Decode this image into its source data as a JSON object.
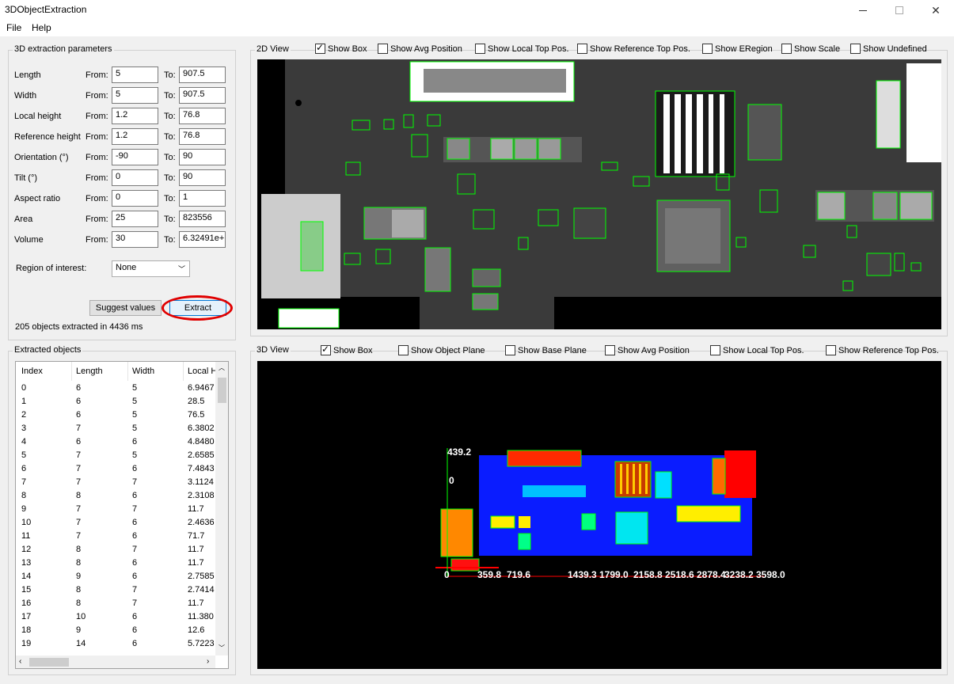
{
  "window": {
    "title": "3DObjectExtraction",
    "min_icon": "minimize-icon",
    "max_icon": "maximize-icon",
    "close_icon": "close-icon"
  },
  "menu": [
    "File",
    "Help"
  ],
  "params": {
    "group_title": "3D extraction parameters",
    "from_label": "From:",
    "to_label": "To:",
    "rows": [
      {
        "label": "Length",
        "from": "5",
        "to": "907.5"
      },
      {
        "label": "Width",
        "from": "5",
        "to": "907.5"
      },
      {
        "label": "Local height",
        "from": "1.2",
        "to": "76.8"
      },
      {
        "label": "Reference height",
        "from": "1.2",
        "to": "76.8"
      },
      {
        "label": "Orientation (°)",
        "from": "-90",
        "to": "90"
      },
      {
        "label": "Tilt (°)",
        "from": "0",
        "to": "90"
      },
      {
        "label": "Aspect ratio",
        "from": "0",
        "to": "1"
      },
      {
        "label": "Area",
        "from": "25",
        "to": "823556"
      },
      {
        "label": "Volume",
        "from": "30",
        "to": "6.32491e+"
      }
    ],
    "roi_label": "Region of interest:",
    "roi_value": "None",
    "suggest_label": "Suggest values",
    "extract_label": "Extract",
    "status": "205 objects extracted in 4436 ms",
    "highlight_color": "#e00000"
  },
  "objects": {
    "group_title": "Extracted objects",
    "columns": [
      "Index",
      "Length",
      "Width",
      "Local H"
    ],
    "rows": [
      [
        "0",
        "6",
        "5",
        "6.9467"
      ],
      [
        "1",
        "6",
        "5",
        "28.5"
      ],
      [
        "2",
        "6",
        "5",
        "76.5"
      ],
      [
        "3",
        "7",
        "5",
        "6.3802"
      ],
      [
        "4",
        "6",
        "6",
        "4.8480"
      ],
      [
        "5",
        "7",
        "5",
        "2.6585"
      ],
      [
        "6",
        "7",
        "6",
        "7.4843"
      ],
      [
        "7",
        "7",
        "7",
        "3.1124"
      ],
      [
        "8",
        "8",
        "6",
        "2.3108"
      ],
      [
        "9",
        "7",
        "7",
        "11.7"
      ],
      [
        "10",
        "7",
        "6",
        "2.4636"
      ],
      [
        "11",
        "7",
        "6",
        "71.7"
      ],
      [
        "12",
        "8",
        "7",
        "11.7"
      ],
      [
        "13",
        "8",
        "6",
        "11.7"
      ],
      [
        "14",
        "9",
        "6",
        "2.7585"
      ],
      [
        "15",
        "8",
        "7",
        "2.7414"
      ],
      [
        "16",
        "8",
        "7",
        "11.7"
      ],
      [
        "17",
        "10",
        "6",
        "11.380"
      ],
      [
        "18",
        "9",
        "6",
        "12.6"
      ],
      [
        "19",
        "14",
        "6",
        "5.7223"
      ]
    ]
  },
  "view2d": {
    "title": "2D View",
    "checkboxes": [
      {
        "label": "Show Box",
        "checked": true
      },
      {
        "label": "Show Avg Position",
        "checked": false
      },
      {
        "label": "Show Local Top Pos.",
        "checked": false
      },
      {
        "label": "Show Reference Top Pos.",
        "checked": false
      },
      {
        "label": "Show ERegion",
        "checked": false
      },
      {
        "label": "Show Scale",
        "checked": false
      },
      {
        "label": "Show Undefined",
        "checked": false
      }
    ]
  },
  "view3d": {
    "title": "3D View",
    "checkboxes": [
      {
        "label": "Show Box",
        "checked": true
      },
      {
        "label": "Show Object Plane",
        "checked": false
      },
      {
        "label": "Show Base Plane",
        "checked": false
      },
      {
        "label": "Show Avg Position",
        "checked": false
      },
      {
        "label": "Show Local Top Pos.",
        "checked": false
      },
      {
        "label": "Show Reference Top Pos.",
        "checked": false
      }
    ],
    "axis_y_top": "439.2",
    "axis_y_mid": "0",
    "axis_x_ticks": [
      "0",
      "359.8",
      "719.6",
      "1439.3",
      "1799.0",
      "2158.8",
      "2518.6",
      "2878.4",
      "3238.2",
      "3598.0"
    ]
  }
}
